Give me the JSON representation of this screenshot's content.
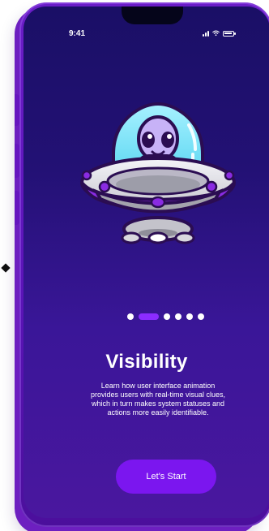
{
  "status_bar": {
    "time": "9:41"
  },
  "onboarding": {
    "title": "Visibility",
    "description": "Learn how user interface animation provides users with real-time visual clues, which in turn makes system statuses and actions more easily identifiable.",
    "button_label": "Let's Start",
    "active_page": 2,
    "page_count": 6
  },
  "icons": {
    "illustration": "alien-ufo-illustration",
    "signal": "signal-icon",
    "wifi": "wifi-icon",
    "battery": "battery-icon",
    "diamond": "diamond-icon"
  },
  "colors": {
    "accent": "#7B16EF",
    "active_dot": "#8B2CFF",
    "screen_top": "#1A0F66",
    "screen_bottom": "#4A179F"
  }
}
